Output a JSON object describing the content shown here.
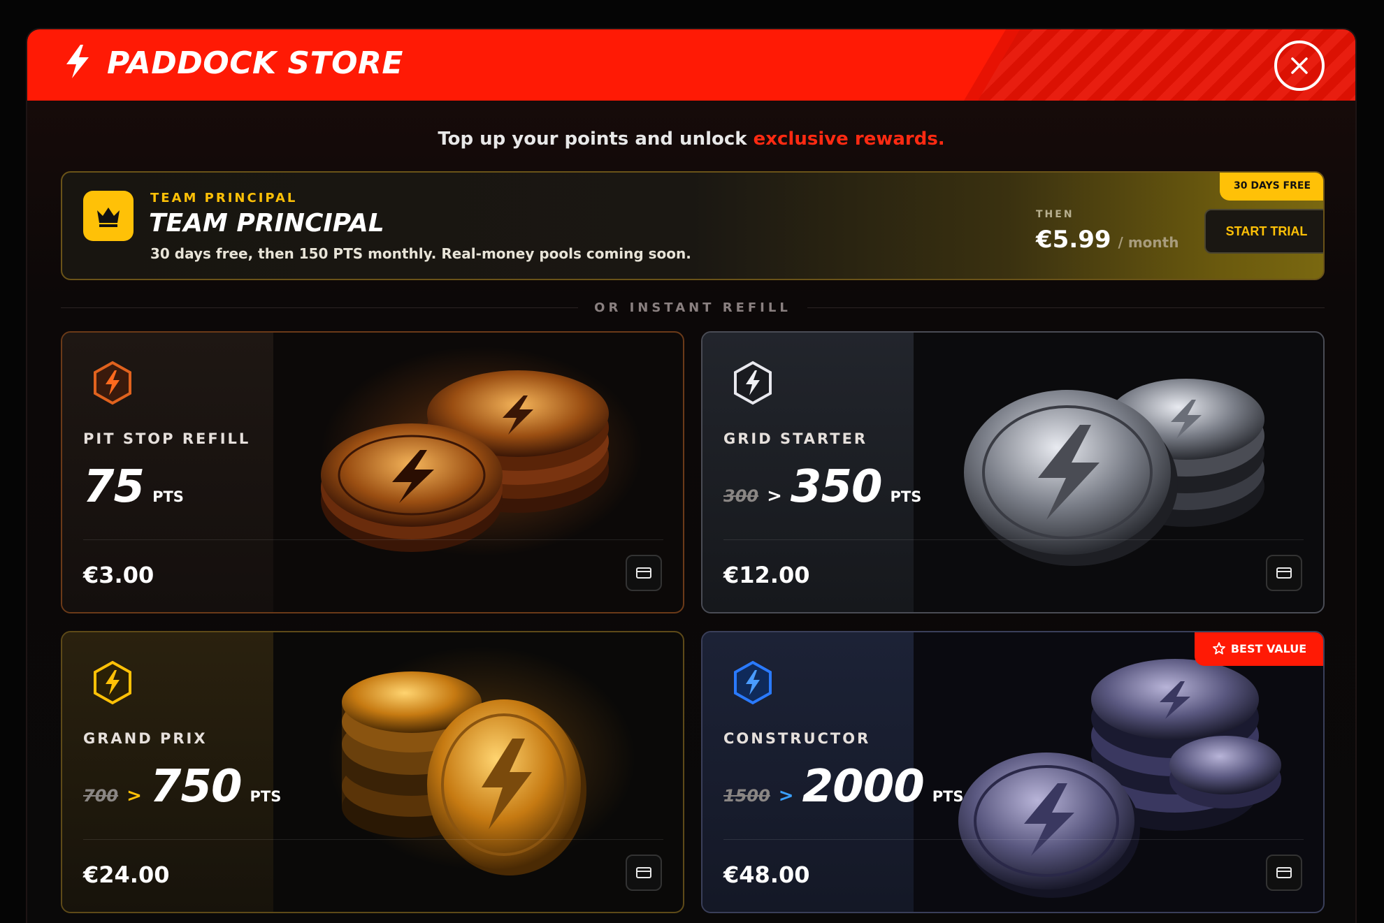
{
  "header": {
    "title": "PADDOCK STORE",
    "icon": "bolt-icon",
    "close_icon": "close-icon"
  },
  "subtitle": {
    "text": "Top up your points and unlock ",
    "accent": "exclusive rewards."
  },
  "principal": {
    "eyebrow": "TEAM PRINCIPAL",
    "title": "TEAM PRINCIPAL",
    "description": "30 days free, then 150 PTS monthly. Real-money pools coming soon.",
    "then_label": "THEN",
    "price": "€5.99",
    "per": "/ month",
    "cta": "START TRIAL",
    "badge": "30 DAYS FREE",
    "icon": "crown-icon"
  },
  "divider": {
    "label": "OR INSTANT REFILL"
  },
  "packs": [
    {
      "tier": "PIT STOP REFILL",
      "old_pts": "",
      "arrow": "",
      "pts": "75",
      "unit": "PTS",
      "price": "€3.00",
      "icon": "bolt-hex-icon",
      "coin": "bronze"
    },
    {
      "tier": "GRID STARTER",
      "old_pts": "300",
      "arrow": ">",
      "pts": "350",
      "unit": "PTS",
      "price": "€12.00",
      "icon": "bolt-hex-icon",
      "coin": "silver"
    },
    {
      "tier": "GRAND PRIX",
      "old_pts": "700",
      "arrow": ">",
      "pts": "750",
      "unit": "PTS",
      "price": "€24.00",
      "icon": "bolt-hex-icon",
      "coin": "gold"
    },
    {
      "tier": "CONSTRUCTOR",
      "old_pts": "1500",
      "arrow": ">",
      "pts": "2000",
      "unit": "PTS",
      "price": "€48.00",
      "icon": "bolt-hex-icon",
      "coin": "platinum",
      "badge": "BEST VALUE"
    }
  ],
  "colors": {
    "brand_red": "#ff1a05",
    "gold": "#ffc107",
    "blue": "#3aa0ff"
  }
}
